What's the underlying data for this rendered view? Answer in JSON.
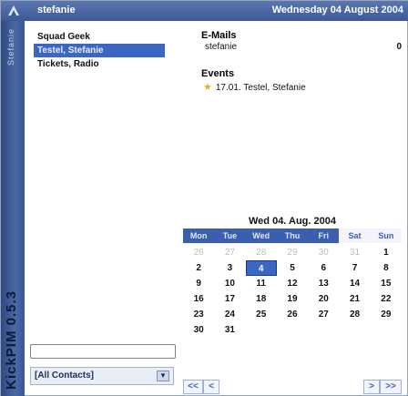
{
  "titlebar": {
    "user": "stefanie",
    "date": "Wednesday 04 August 2004"
  },
  "sidebar": {
    "top_label": "Stefanie",
    "version": "KickPIM 0.5.3"
  },
  "contacts": [
    {
      "name": "Squad Geek",
      "selected": false
    },
    {
      "name": "Testel, Stefanie",
      "selected": true
    },
    {
      "name": "Tickets, Radio",
      "selected": false
    }
  ],
  "emails": {
    "title": "E-Mails",
    "account": "stefanie",
    "count": "0"
  },
  "events": {
    "title": "Events",
    "items": [
      {
        "text": "17.01. Testel, Stefanie"
      }
    ]
  },
  "calendar": {
    "title": "Wed 04. Aug. 2004",
    "weekdays": [
      "Mon",
      "Tue",
      "Wed",
      "Thu",
      "Fri",
      "Sat",
      "Sun"
    ],
    "weeks": [
      [
        "26",
        "27",
        "28",
        "29",
        "30",
        "31",
        "1"
      ],
      [
        "2",
        "3",
        "4",
        "5",
        "6",
        "7",
        "8"
      ],
      [
        "9",
        "10",
        "11",
        "12",
        "13",
        "14",
        "15"
      ],
      [
        "16",
        "17",
        "18",
        "19",
        "20",
        "21",
        "22"
      ],
      [
        "23",
        "24",
        "25",
        "26",
        "27",
        "28",
        "29"
      ],
      [
        "30",
        "31",
        "",
        "",
        "",
        "",
        ""
      ]
    ],
    "today": "4"
  },
  "nav": {
    "prev_year": "<<",
    "prev_month": "<",
    "next_month": ">",
    "next_year": ">>"
  },
  "search": {
    "value": ""
  },
  "filter": {
    "selected": "[All Contacts]"
  },
  "colors": {
    "accent": "#3b5fae",
    "selection": "#3b66c2"
  }
}
